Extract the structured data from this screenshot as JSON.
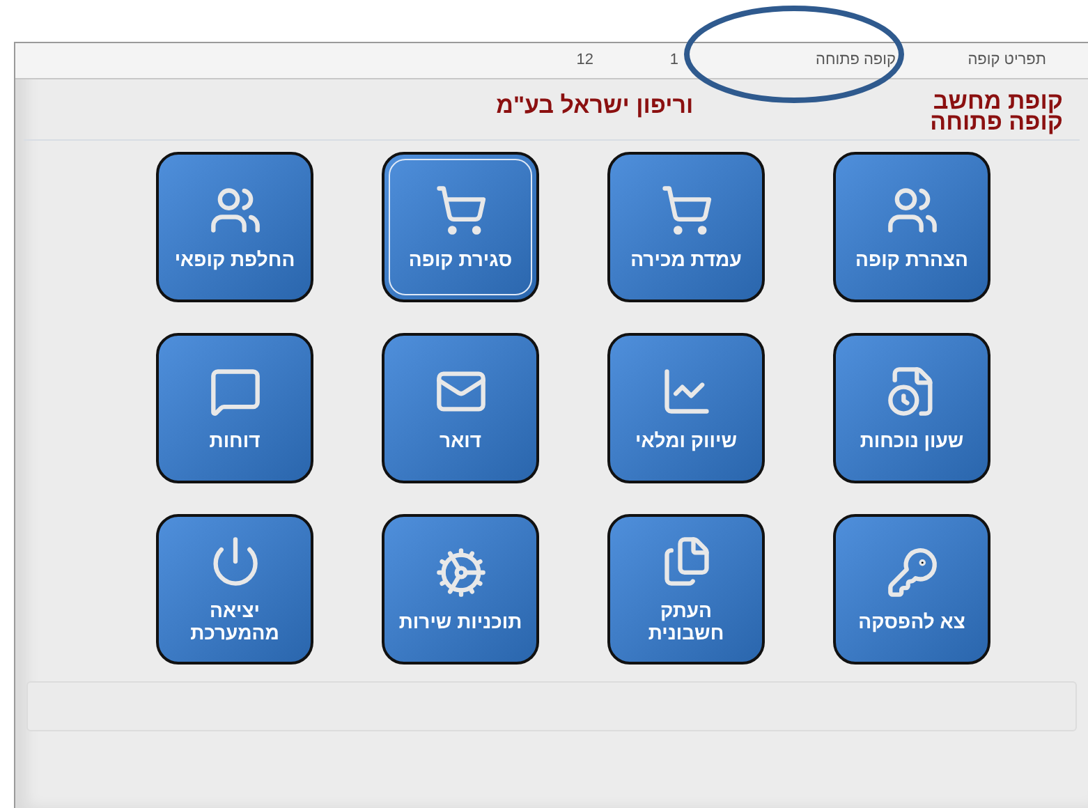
{
  "top_bar": {
    "items": [
      "תפריט קופה",
      "קופה פתוחה",
      "1",
      "12"
    ]
  },
  "header": {
    "title": "קופת מחשב",
    "subtitle": "קופה פתוחה",
    "company": "וריפון ישראל בע\"מ"
  },
  "menu_buttons": [
    {
      "label": "הצהרת קופה",
      "selected": false
    },
    {
      "label": "עמדת מכירה",
      "selected": false
    },
    {
      "label": "סגירת קופה",
      "selected": true
    },
    {
      "label": "החלפת קופאי",
      "selected": false
    },
    {
      "label": "שעון נוכחות",
      "selected": false
    },
    {
      "label": "שיווק ומלאי",
      "selected": false
    },
    {
      "label": "דואר",
      "selected": false
    },
    {
      "label": "דוחות",
      "selected": false
    },
    {
      "label": "צא להפסקה",
      "selected": false
    },
    {
      "label": "העתק חשבונית",
      "selected": false
    },
    {
      "label": "תוכניות שירות",
      "selected": false
    },
    {
      "label": "יציאה מהמערכת",
      "selected": false
    }
  ]
}
